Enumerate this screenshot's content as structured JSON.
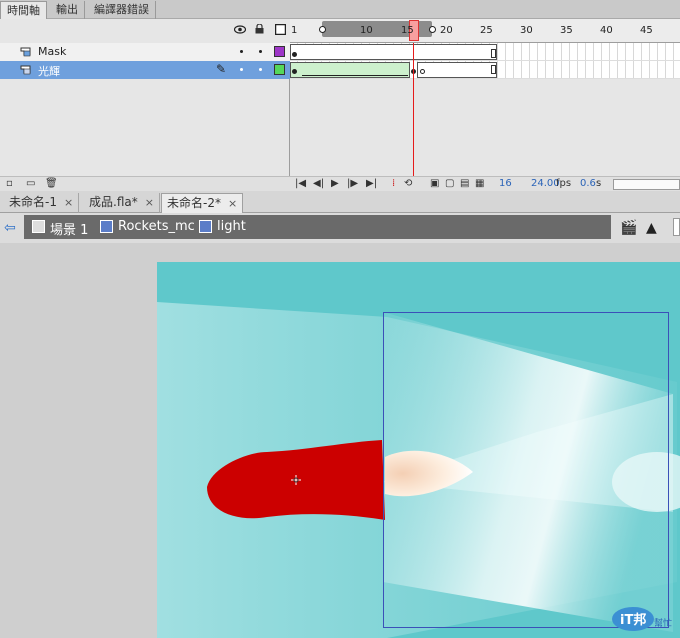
{
  "panel_tabs": [
    "時間軸",
    "輸出",
    "編譯器錯誤"
  ],
  "timeline": {
    "header_icons": {
      "eye": "eye-icon",
      "lock": "lock-icon",
      "outline": "outline-icon"
    },
    "ruler_labels": [
      "1",
      "10",
      "15",
      "20",
      "25",
      "30",
      "35",
      "40",
      "45"
    ],
    "current_frame": "16",
    "layers": [
      {
        "name": "Mask",
        "color": "#9e36c8",
        "type": "mask-layer-icon"
      },
      {
        "name": "光輝",
        "color": "#55d75a",
        "type": "masked-layer-icon",
        "selected": true
      }
    ],
    "footer": {
      "frame": "16",
      "fps": "24.00",
      "fps_unit": "fps",
      "time": "0.6",
      "time_unit": "s"
    }
  },
  "doc_tabs": [
    {
      "label": "未命名-1",
      "close": "×"
    },
    {
      "label": "成品.fla*",
      "close": "×"
    },
    {
      "label": "未命名-2*",
      "close": "×",
      "active": true
    }
  ],
  "breadcrumbs": [
    {
      "label": "場景 1",
      "icon": "scene-icon"
    },
    {
      "label": "Rockets_mc",
      "icon": "movieclip-icon"
    },
    {
      "label": "light",
      "icon": "movieclip-icon"
    }
  ],
  "colors": {
    "stage_bg": "#5fc8cb",
    "rocket": "#cc0000",
    "playhead": "#e51b1b",
    "selection": "#6fa0dd"
  },
  "watermark": {
    "text": "iT邦",
    "sub": "幫忙"
  }
}
